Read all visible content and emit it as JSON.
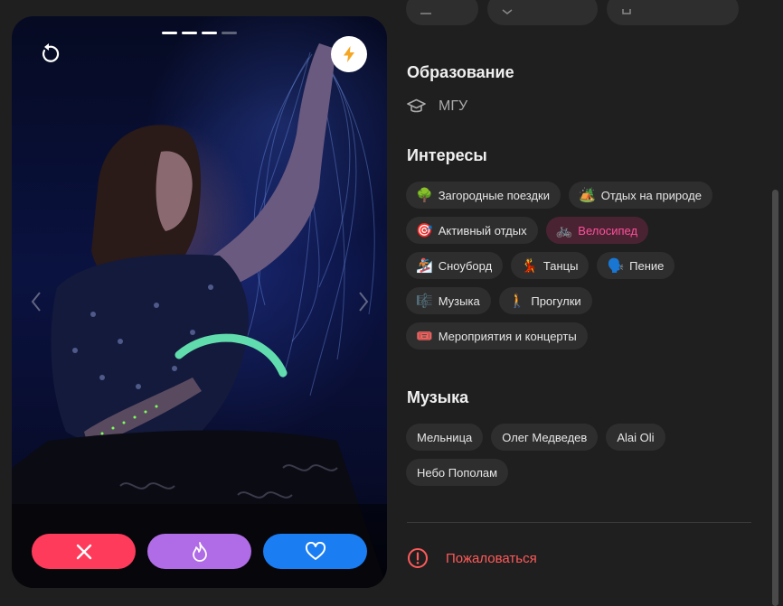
{
  "card": {
    "photo_count": 4,
    "photo_active_index": 3
  },
  "education": {
    "title": "Образование",
    "value": "МГУ"
  },
  "interests": {
    "title": "Интересы",
    "items": [
      {
        "emoji": "🌳",
        "label": "Загородные поездки",
        "active": false
      },
      {
        "emoji": "🏕️",
        "label": "Отдых на природе",
        "active": false
      },
      {
        "emoji": "🎯",
        "label": "Активный отдых",
        "active": false
      },
      {
        "emoji": "🚲",
        "label": "Велосипед",
        "active": true
      },
      {
        "emoji": "🏂",
        "label": "Сноуборд",
        "active": false
      },
      {
        "emoji": "💃",
        "label": "Танцы",
        "active": false
      },
      {
        "emoji": "🗣️",
        "label": "Пение",
        "active": false
      },
      {
        "emoji": "🎼",
        "label": "Музыка",
        "active": false
      },
      {
        "emoji": "🚶",
        "label": "Прогулки",
        "active": false
      },
      {
        "emoji": "🎟️",
        "label": "Мероприятия и концерты",
        "active": false
      }
    ]
  },
  "music": {
    "title": "Музыка",
    "items": [
      "Мельница",
      "Олег Медведев",
      "Alai Oli",
      "Небо Пополам"
    ]
  },
  "report": {
    "label": "Пожаловаться"
  },
  "colors": {
    "nope": "#ff3b5c",
    "superlike": "#b06be6",
    "like": "#1a7df2",
    "active_chip_text": "#ff4f9a",
    "report": "#ff5a5a"
  }
}
